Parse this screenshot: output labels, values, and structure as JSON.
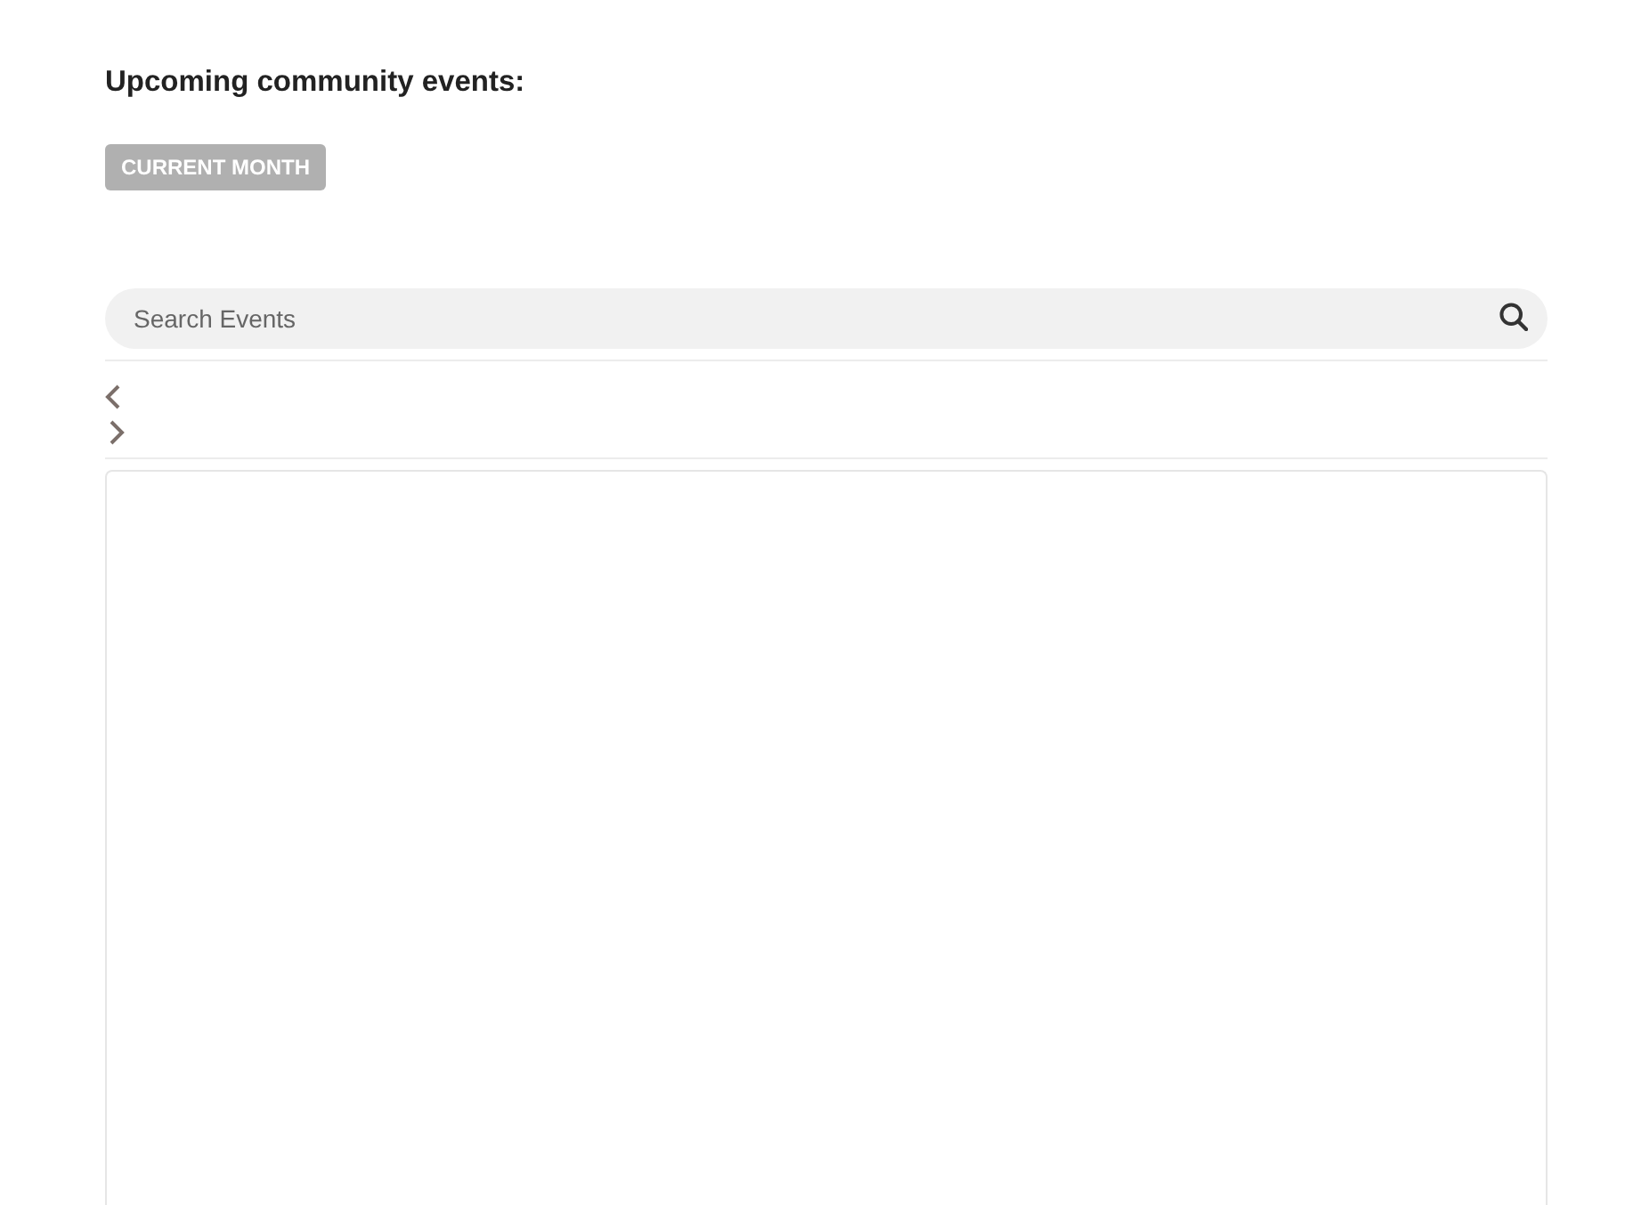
{
  "heading": "Upcoming community events:",
  "current_month_button": {
    "label": "CURRENT MONTH",
    "disabled": true
  },
  "search": {
    "placeholder": "Search Events"
  }
}
